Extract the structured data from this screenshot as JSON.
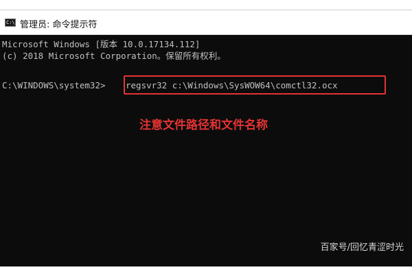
{
  "window": {
    "title": "管理员: 命令提示符",
    "icon": "cmd-icon",
    "icon_text": "C:\\"
  },
  "console": {
    "lines": [
      "Microsoft Windows [版本 10.0.17134.112]",
      "(c) 2018 Microsoft Corporation。保留所有权利。"
    ],
    "prompt": "C:\\WINDOWS\\system32>",
    "command": "regsvr32 c:\\Windows\\SysWOW64\\comctl32.ocx"
  },
  "annotation": {
    "text": "注意文件路径和文件名称",
    "color": "#e53333"
  },
  "watermark": {
    "text": "百家号/回忆青涩时光"
  },
  "colors": {
    "console_bg": "#0c0c0c",
    "console_text": "#c0c0c0",
    "highlight": "#e53333"
  }
}
